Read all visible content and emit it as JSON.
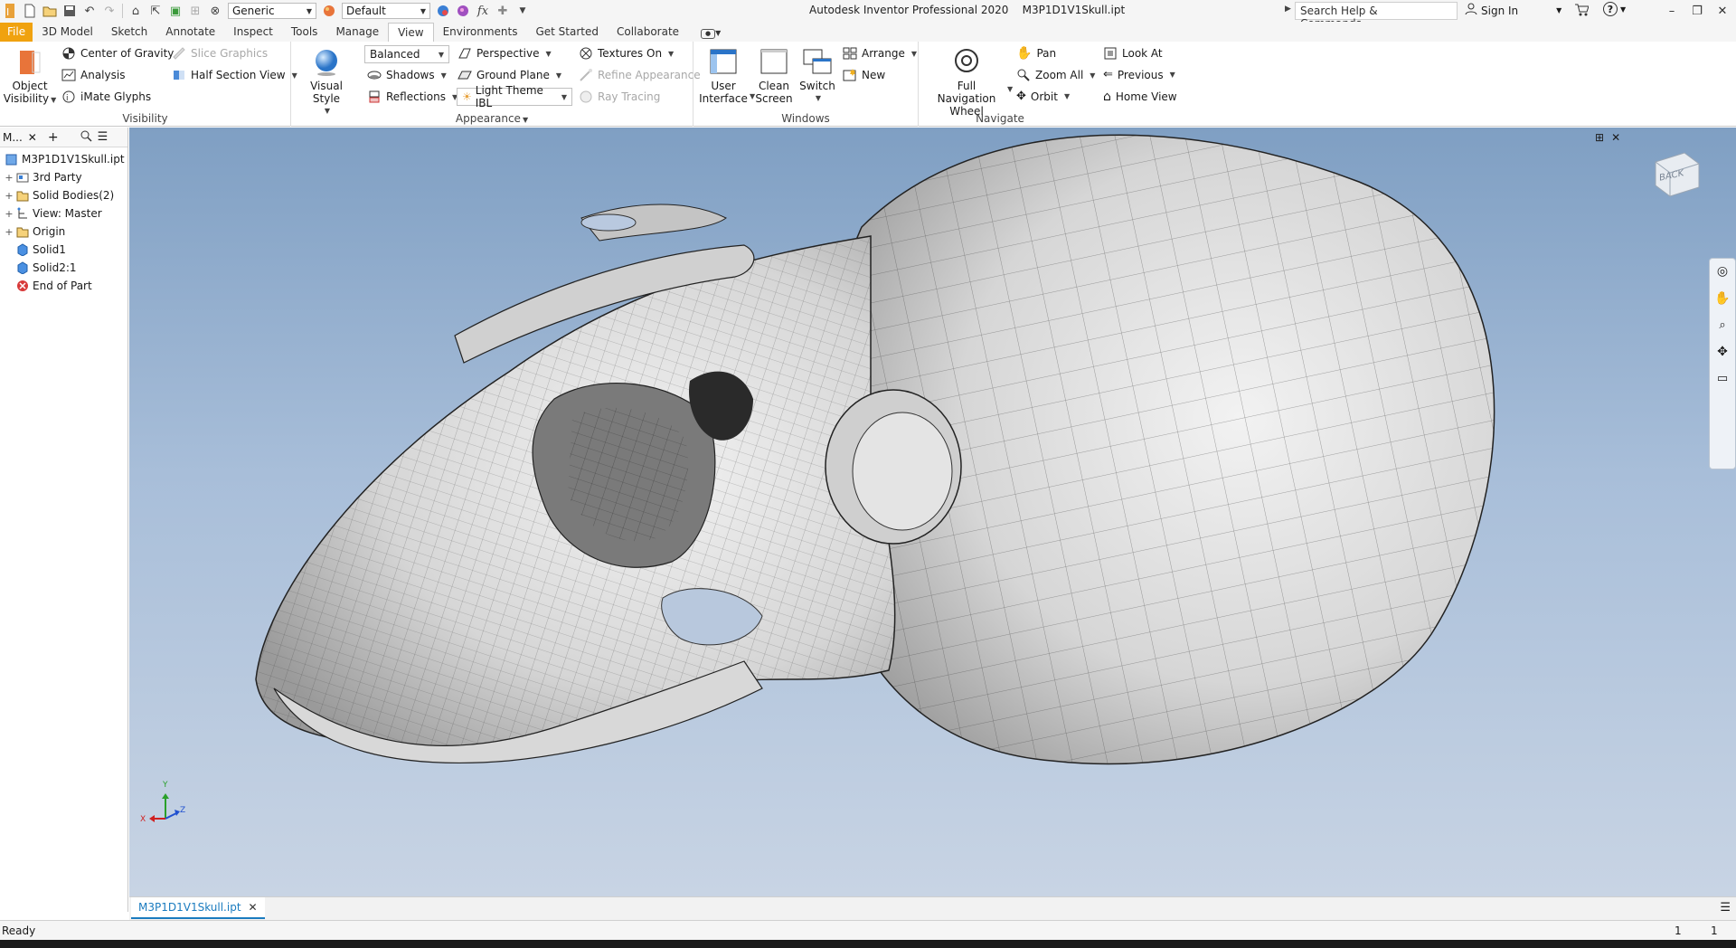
{
  "titlebar": {
    "title": "Autodesk Inventor Professional 2020    M3P1D1V1Skull.ipt",
    "material_combo": "Generic",
    "appearance_combo": "Default",
    "fx": "fx",
    "search_placeholder": "Search Help & Commands...",
    "sign_in": "Sign In"
  },
  "tabs": [
    "File",
    "3D Model",
    "Sketch",
    "Annotate",
    "Inspect",
    "Tools",
    "Manage",
    "View",
    "Environments",
    "Get Started",
    "Collaborate"
  ],
  "active_tab": "View",
  "ribbon": {
    "visibility": {
      "label": "Visibility",
      "object_visibility": "Object\nVisibility",
      "object_visibility_l1": "Object",
      "object_visibility_l2": "Visibility",
      "center_of_gravity": "Center of Gravity",
      "slice_graphics": "Slice Graphics",
      "analysis": "Analysis",
      "half_section_view": "Half Section View",
      "imate_glyphs": "iMate Glyphs"
    },
    "appearance": {
      "label": "Appearance",
      "visual_style": "Visual Style",
      "balanced": "Balanced",
      "perspective": "Perspective",
      "textures_on": "Textures On",
      "shadows": "Shadows",
      "ground_plane": "Ground Plane",
      "refine_appearance": "Refine Appearance",
      "reflections": "Reflections",
      "light_theme": "Light Theme IBL",
      "ray_tracing": "Ray Tracing"
    },
    "windows": {
      "label": "Windows",
      "user_interface_l1": "User",
      "user_interface_l2": "Interface",
      "clean_screen_l1": "Clean",
      "clean_screen_l2": "Screen",
      "switch": "Switch",
      "arrange": "Arrange",
      "new": "New"
    },
    "navigate": {
      "label": "Navigate",
      "full_nav_l1": "Full Navigation",
      "full_nav_l2": "Wheel",
      "pan": "Pan",
      "look_at": "Look At",
      "zoom_all": "Zoom All",
      "previous": "Previous",
      "orbit": "Orbit",
      "home_view": "Home View"
    }
  },
  "browser": {
    "tab_label": "M...",
    "items": [
      {
        "label": "M3P1D1V1Skull.ipt",
        "icon": "part-file-icon"
      },
      {
        "label": "3rd Party",
        "icon": "third-party-icon"
      },
      {
        "label": "Solid Bodies(2)",
        "icon": "folder-icon"
      },
      {
        "label": "View: Master",
        "icon": "view-rep-icon"
      },
      {
        "label": "Origin",
        "icon": "folder-icon"
      },
      {
        "label": "Solid1",
        "icon": "solid-body-icon"
      },
      {
        "label": "Solid2:1",
        "icon": "solid-body-icon"
      },
      {
        "label": "End of Part",
        "icon": "end-of-part-icon"
      }
    ]
  },
  "viewport": {
    "viewcube_label": "BACK",
    "triad": {
      "x": "X",
      "y": "Y",
      "z": "Z"
    }
  },
  "document_tab": "M3P1D1V1Skull.ipt",
  "status": {
    "text": "Ready",
    "count1": "1",
    "count2": "1"
  },
  "colors": {
    "file_tab": "#f0a20f",
    "viewport_top": "#7f9fc3",
    "viewport_bottom": "#c8d4e4",
    "accent": "#1a7bbf"
  }
}
